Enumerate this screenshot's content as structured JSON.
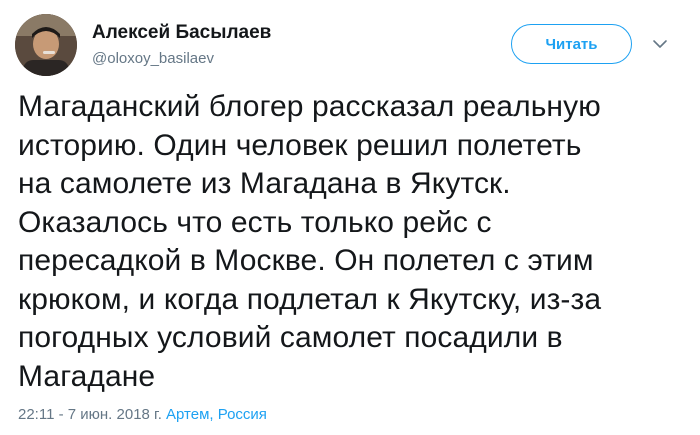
{
  "user": {
    "name": "Алексей Басылаев",
    "handle": "@oloxoy_basilaev"
  },
  "follow_button": {
    "label": "Читать"
  },
  "icons": {
    "menu": "chevron-down-icon",
    "avatar": "avatar-photo"
  },
  "colors": {
    "accent": "#1da1f2",
    "text": "#14171a",
    "secondary": "#657786"
  },
  "tweet": {
    "lines": [
      "Магаданский блогер рассказал реальную",
      "историю. Один человек решил полететь",
      "на самолете из Магадана в Якутск.",
      "Оказалось что есть только рейс с",
      "пересадкой в Москве. Он полетел с этим",
      "крюком, и когда подлетал к Якутску, из-за",
      "погодных условий самолет посадили в",
      "Магадане"
    ],
    "timestamp": "22:11 - 7 июн. 2018 г.",
    "location": "Артем, Россия"
  }
}
